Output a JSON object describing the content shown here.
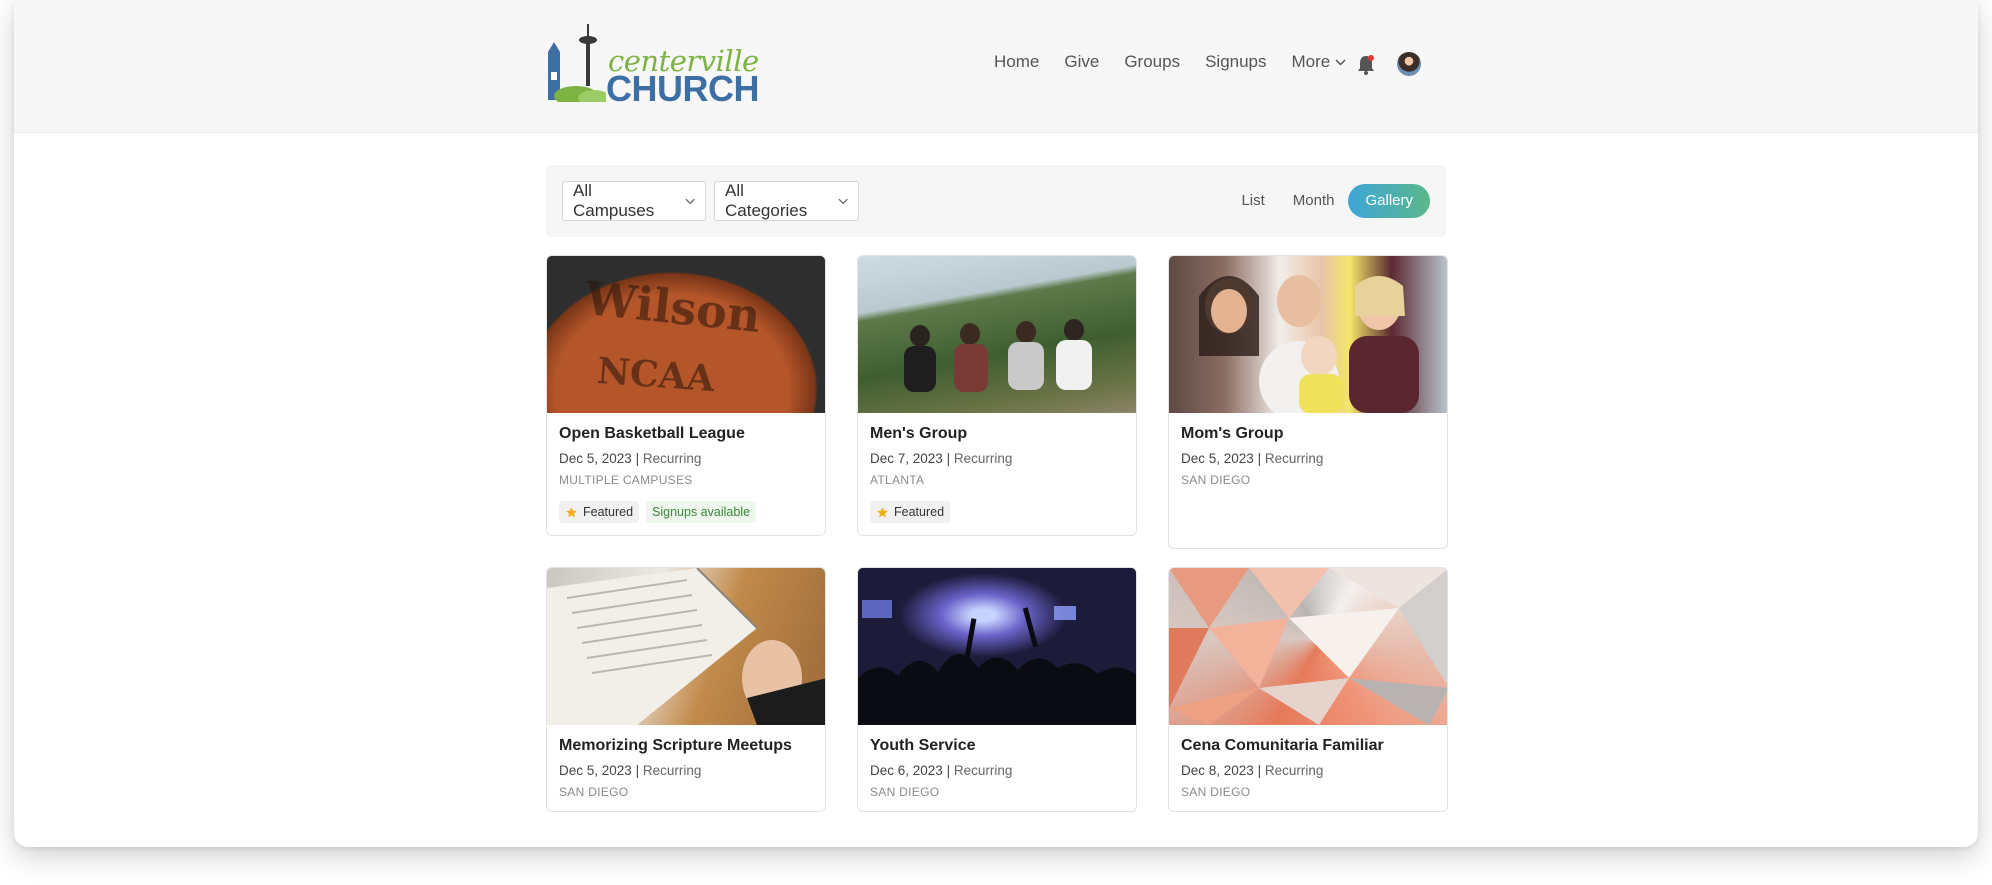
{
  "brand": {
    "line1": "centerville",
    "line2": "CHURCH"
  },
  "nav": {
    "items": [
      "Home",
      "Give",
      "Groups",
      "Signups"
    ],
    "more_label": "More"
  },
  "filters": {
    "campus": "All Campuses",
    "category": "All Categories"
  },
  "views": {
    "list": "List",
    "month": "Month",
    "gallery": "Gallery",
    "active": "gallery"
  },
  "events": [
    {
      "title": "Open Basketball League",
      "date": "Dec 5, 2023",
      "recurring": "Recurring",
      "campus": "MULTIPLE CAMPUSES",
      "badges": [
        "Featured",
        "Signups available"
      ],
      "image": "basketball",
      "image_text": [
        "Wilson",
        "NCAA"
      ]
    },
    {
      "title": "Men's Group",
      "date": "Dec 7, 2023",
      "recurring": "Recurring",
      "campus": "ATLANTA",
      "badges": [
        "Featured"
      ],
      "image": "mens"
    },
    {
      "title": "Mom's Group",
      "date": "Dec 5, 2023",
      "recurring": "Recurring",
      "campus": "SAN DIEGO",
      "badges": [],
      "image": "moms"
    },
    {
      "title": "Memorizing Scripture Meetups",
      "date": "Dec 5, 2023",
      "recurring": "Recurring",
      "campus": "SAN DIEGO",
      "badges": [],
      "image": "bible"
    },
    {
      "title": "Youth Service",
      "date": "Dec 6, 2023",
      "recurring": "Recurring",
      "campus": "SAN DIEGO",
      "badges": [],
      "image": "youth"
    },
    {
      "title": "Cena Comunitaria Familiar",
      "date": "Dec 8, 2023",
      "recurring": "Recurring",
      "campus": "SAN DIEGO",
      "badges": [],
      "image": "poly"
    }
  ],
  "colors": {
    "accent_start": "#3fa6d8",
    "accent_end": "#5ab88a",
    "logo_green": "#7cb342",
    "logo_blue": "#3d6fa5"
  }
}
